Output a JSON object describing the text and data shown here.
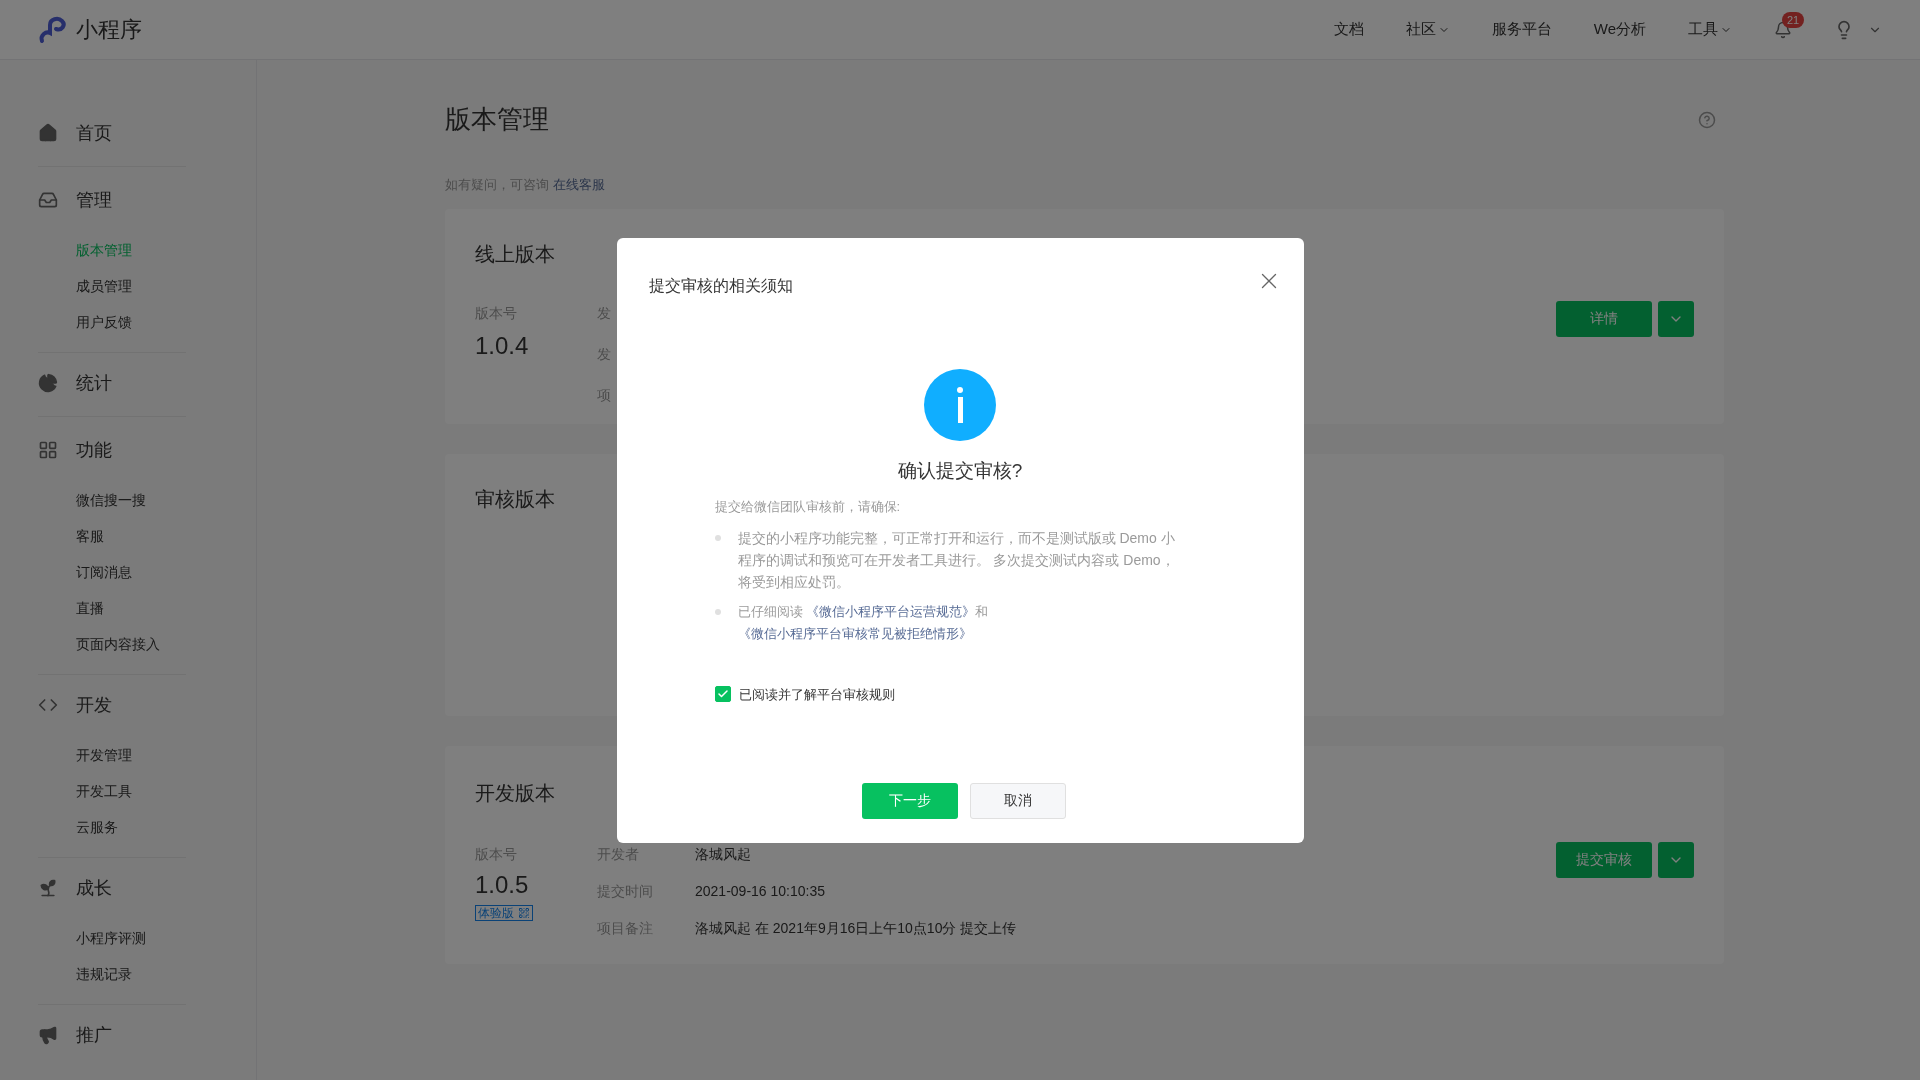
{
  "topbar": {
    "logo_text": "小程序",
    "nav": [
      {
        "label": "文档",
        "dropdown": false
      },
      {
        "label": "社区",
        "dropdown": true
      },
      {
        "label": "服务平台",
        "dropdown": false
      },
      {
        "label": "We分析",
        "dropdown": false
      },
      {
        "label": "工具",
        "dropdown": true
      }
    ],
    "notification_count": "21"
  },
  "sidebar": {
    "sections": [
      {
        "label": "首页"
      },
      {
        "label": "管理",
        "items": [
          {
            "label": "版本管理",
            "selected": true
          },
          {
            "label": "成员管理",
            "selected": false
          },
          {
            "label": "用户反馈",
            "selected": false
          }
        ]
      },
      {
        "label": "统计"
      },
      {
        "label": "功能",
        "items": [
          {
            "label": "微信搜一搜",
            "selected": false
          },
          {
            "label": "客服",
            "selected": false
          },
          {
            "label": "订阅消息",
            "selected": false
          },
          {
            "label": "直播",
            "selected": false
          },
          {
            "label": "页面内容接入",
            "selected": false
          }
        ]
      },
      {
        "label": "开发",
        "items": [
          {
            "label": "开发管理",
            "selected": false
          },
          {
            "label": "开发工具",
            "selected": false
          },
          {
            "label": "云服务",
            "selected": false
          }
        ]
      },
      {
        "label": "成长",
        "items": [
          {
            "label": "小程序评测",
            "selected": false
          },
          {
            "label": "违规记录",
            "selected": false
          }
        ]
      },
      {
        "label": "推广"
      }
    ]
  },
  "page": {
    "title": "版本管理",
    "help_text": "如有疑问，可咨询",
    "help_link": "在线客服"
  },
  "online_version": {
    "title": "线上版本",
    "version_label": "版本号",
    "version": "1.0.4",
    "field_labels": [
      "发",
      "发",
      "项"
    ],
    "button": "详情"
  },
  "review_version": {
    "title": "审核版本"
  },
  "dev_version": {
    "title": "开发版本",
    "version_label": "版本号",
    "version": "1.0.5",
    "badge": "体验版",
    "fields": [
      {
        "label": "开发者",
        "value": "洛城风起"
      },
      {
        "label": "提交时间",
        "value": "2021-09-16 10:10:35"
      },
      {
        "label": "项目备注",
        "value": "洛城风起 在 2021年9月16日上午10点10分 提交上传"
      }
    ],
    "button": "提交审核"
  },
  "modal": {
    "title": "提交审核的相关须知",
    "heading": "确认提交审核?",
    "intro": "提交给微信团队审核前，请确保:",
    "bullet_1": "提交的小程序功能完整，可正常打开和运行，而不是测试版或 Demo 小程序的调试和预览可在开发者工具进行。 多次提交测试内容或 Demo，将受到相应处罚。",
    "bullet_2": {
      "prefix": "已仔细阅读",
      "link_1": "《微信小程序平台运营规范》",
      "middle": "和",
      "link_2": "《微信小程序平台审核常见被拒绝情形》"
    },
    "agreement": {
      "label": "已阅读并了解平台审核规则",
      "checked": true
    },
    "primary_button": "下一步",
    "secondary_button": "取消"
  }
}
